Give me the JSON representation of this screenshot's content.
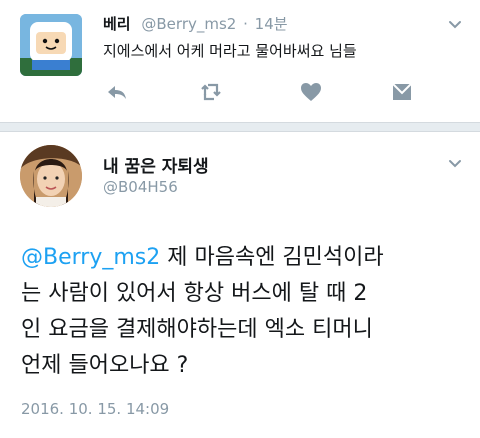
{
  "tweet1": {
    "display_name": "베리",
    "handle": "@Berry_ms2",
    "separator": "·",
    "time": "14분",
    "text": "지에스에서 어케 머라고 물어바써요 님들",
    "actions": [
      "reply-icon",
      "retweet-icon",
      "like-icon",
      "dm-icon"
    ]
  },
  "tweet2": {
    "display_name": "내 꿈은 자퇴생",
    "handle": "@B04H56",
    "mention": "@Berry_ms2",
    "text_line1_rest": " 제 마음속엔 김민석이라",
    "text_line2": "는 사람이 있어서 항상 버스에 탈 때 2",
    "text_line3": "인 요금을 결제해야하는데 엑소 티머니",
    "text_line4": "언제 들어오나요 ?",
    "timestamp": "2016. 10. 15. 14:09"
  },
  "colors": {
    "link": "#1da1f2",
    "muted": "#8899a6",
    "separator_bg": "#e6ecf0"
  }
}
